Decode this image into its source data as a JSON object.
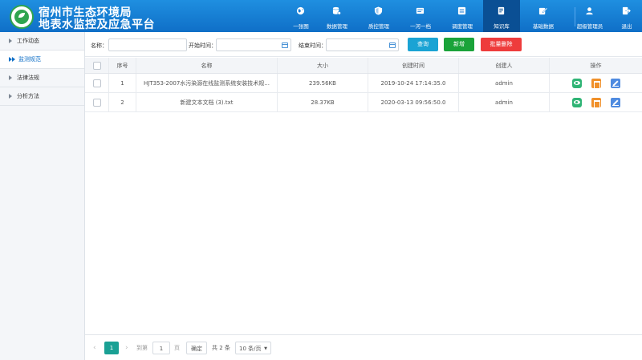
{
  "header": {
    "title_line1": "宿州市生态环境局",
    "title_line2": "地表水监控及应急平台",
    "nav": [
      {
        "label": "一张图",
        "icon": "globe-icon"
      },
      {
        "label": "数据管理",
        "icon": "database-icon"
      },
      {
        "label": "质控管理",
        "icon": "shield-icon"
      },
      {
        "label": "一河一档",
        "icon": "archive-icon"
      },
      {
        "label": "调度管理",
        "icon": "dispatch-icon"
      },
      {
        "label": "知识库",
        "icon": "book-icon",
        "active": true
      },
      {
        "label": "基础数据",
        "icon": "edit-icon"
      },
      {
        "label": "超级管理员",
        "icon": "user-icon"
      },
      {
        "label": "退出",
        "icon": "exit-icon"
      }
    ]
  },
  "sidebar": {
    "items": [
      {
        "label": "工作动态"
      },
      {
        "label": "监测规范",
        "active": true
      },
      {
        "label": "法律法规"
      },
      {
        "label": "分析方法"
      }
    ]
  },
  "toolbar": {
    "name_label": "名称：",
    "start_label": "开始时间：",
    "end_label": "结束时间：",
    "search_btn": "查询",
    "add_btn": "新增",
    "batch_delete_btn": "批量删除"
  },
  "table": {
    "headers": [
      "序号",
      "名称",
      "大小",
      "创建时间",
      "创建人",
      "操作"
    ],
    "rows": [
      {
        "no": "1",
        "name": "HJT353-2007水污染源在线监测系统安装技术规...",
        "size": "239.56KB",
        "created": "2019-10-24 17:14:35.0",
        "creator": "admin"
      },
      {
        "no": "2",
        "name": "新建文本文档 (3).txt",
        "size": "28.37KB",
        "created": "2020-03-13 09:56:50.0",
        "creator": "admin"
      }
    ]
  },
  "pager": {
    "current": "1",
    "goto_label": "到第",
    "goto_value": "1",
    "page_label": "页",
    "confirm_btn": "确定",
    "total": "共 2 条",
    "page_size": "10 条/页"
  },
  "colors": {
    "header": "#0f6fc7",
    "accent_teal": "#1aa094",
    "search_btn": "#1aa3d4",
    "add_btn": "#1aa33a",
    "delete_btn": "#ee3c3c"
  }
}
